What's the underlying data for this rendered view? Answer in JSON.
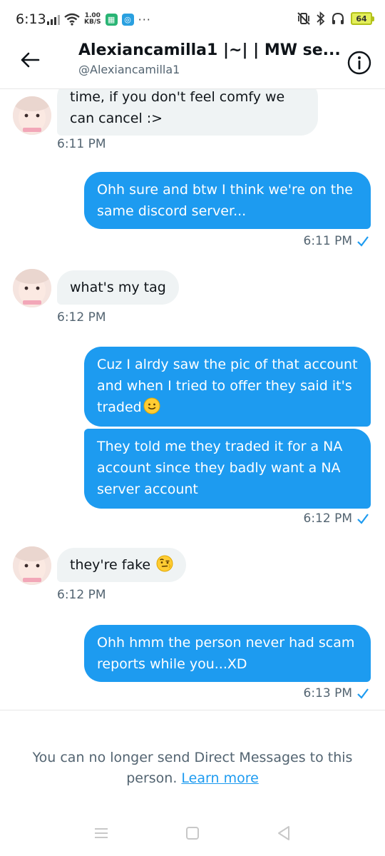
{
  "status_bar": {
    "time": "6:13",
    "net_speed_value": "1.00",
    "net_speed_unit": "KB/S",
    "battery": "64"
  },
  "header": {
    "title": "Alexiancamilla1 |~| | MW se...",
    "handle": "@Alexiancamilla1"
  },
  "messages": [
    {
      "dir": "in",
      "lines": [
        "time, if you don't feel comfy we",
        "can cancel :>"
      ],
      "time": "6:11 PM"
    },
    {
      "dir": "out",
      "text": "Ohh sure and btw I think we're on the same discord server...",
      "time": "6:11 PM"
    },
    {
      "dir": "in",
      "text": "what's my tag",
      "time": "6:12 PM"
    },
    {
      "dir": "out",
      "text": "Cuz I alrdy saw the pic of that account and when I tried to offer they said it's traded",
      "emoji": "slightly-smiling-face"
    },
    {
      "dir": "out",
      "text": "They told me they traded it for a NA account since they badly want a NA server account",
      "time": "6:12 PM"
    },
    {
      "dir": "in",
      "text": "they're fake ",
      "emoji": "face-with-raised-eyebrow",
      "time": "6:12 PM"
    },
    {
      "dir": "out",
      "text": "Ohh hmm the person never had scam reports while you...XD",
      "time": "6:13 PM"
    }
  ],
  "notice": {
    "text": "You can no longer send Direct Messages to this person.",
    "link": "Learn more"
  },
  "colors": {
    "accent": "#1d9bf0",
    "incoming_bubble": "#eff3f4",
    "secondary_text": "#536471"
  },
  "icons": [
    "back-arrow-icon",
    "info-icon",
    "read-check-icon",
    "menu-nav-icon",
    "home-nav-icon",
    "back-nav-icon"
  ]
}
